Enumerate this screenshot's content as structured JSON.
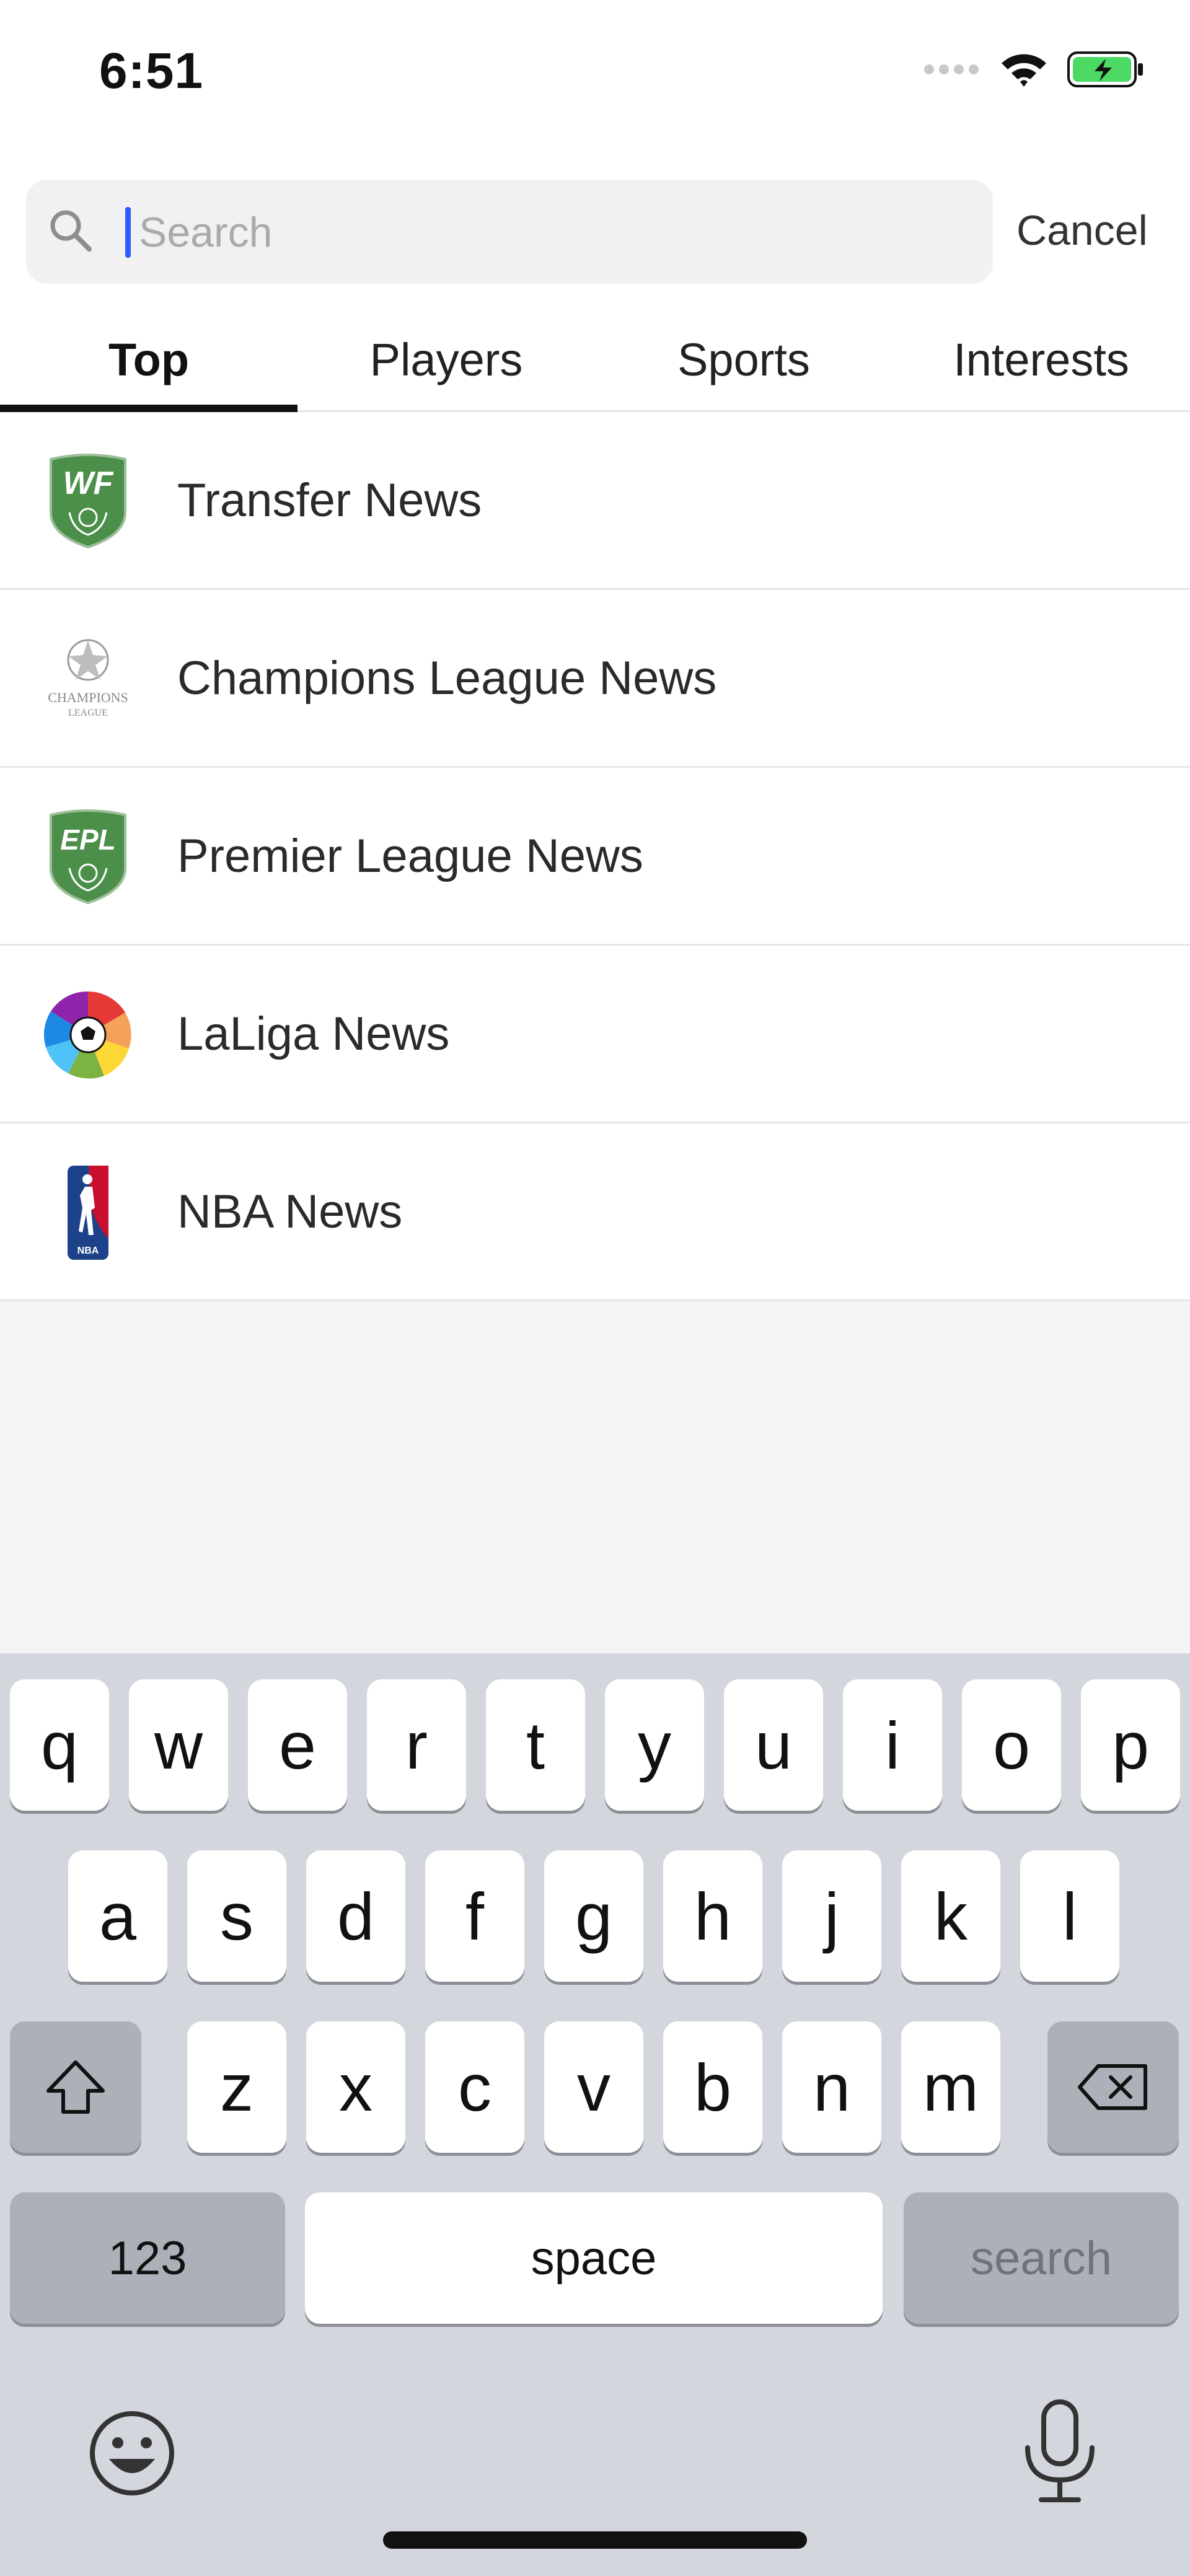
{
  "status_bar": {
    "time": "6:51"
  },
  "search": {
    "placeholder": "Search",
    "value": "",
    "cancel_label": "Cancel"
  },
  "tabs": [
    {
      "label": "Top",
      "active": true
    },
    {
      "label": "Players",
      "active": false
    },
    {
      "label": "Sports",
      "active": false
    },
    {
      "label": "Interests",
      "active": false
    }
  ],
  "results": [
    {
      "label": "Transfer News",
      "icon": "wf-badge-icon",
      "badge_text": "WF"
    },
    {
      "label": "Champions League News",
      "icon": "champions-league-icon",
      "badge_text": "CHAMPIONS LEAGUE"
    },
    {
      "label": "Premier League News",
      "icon": "epl-badge-icon",
      "badge_text": "EPL"
    },
    {
      "label": "LaLiga News",
      "icon": "laliga-icon"
    },
    {
      "label": "NBA News",
      "icon": "nba-icon",
      "badge_text": "NBA"
    }
  ],
  "keyboard": {
    "row1": [
      "q",
      "w",
      "e",
      "r",
      "t",
      "y",
      "u",
      "i",
      "o",
      "p"
    ],
    "row2": [
      "a",
      "s",
      "d",
      "f",
      "g",
      "h",
      "j",
      "k",
      "l"
    ],
    "row3": [
      "z",
      "x",
      "c",
      "v",
      "b",
      "n",
      "m"
    ],
    "numbers_label": "123",
    "space_label": "space",
    "search_label": "search"
  },
  "colors": {
    "accent_caret": "#2e5bff",
    "badge_green": "#4c8f4a",
    "keyboard_bg": "#d3d6dc",
    "battery_green": "#4cd964"
  }
}
